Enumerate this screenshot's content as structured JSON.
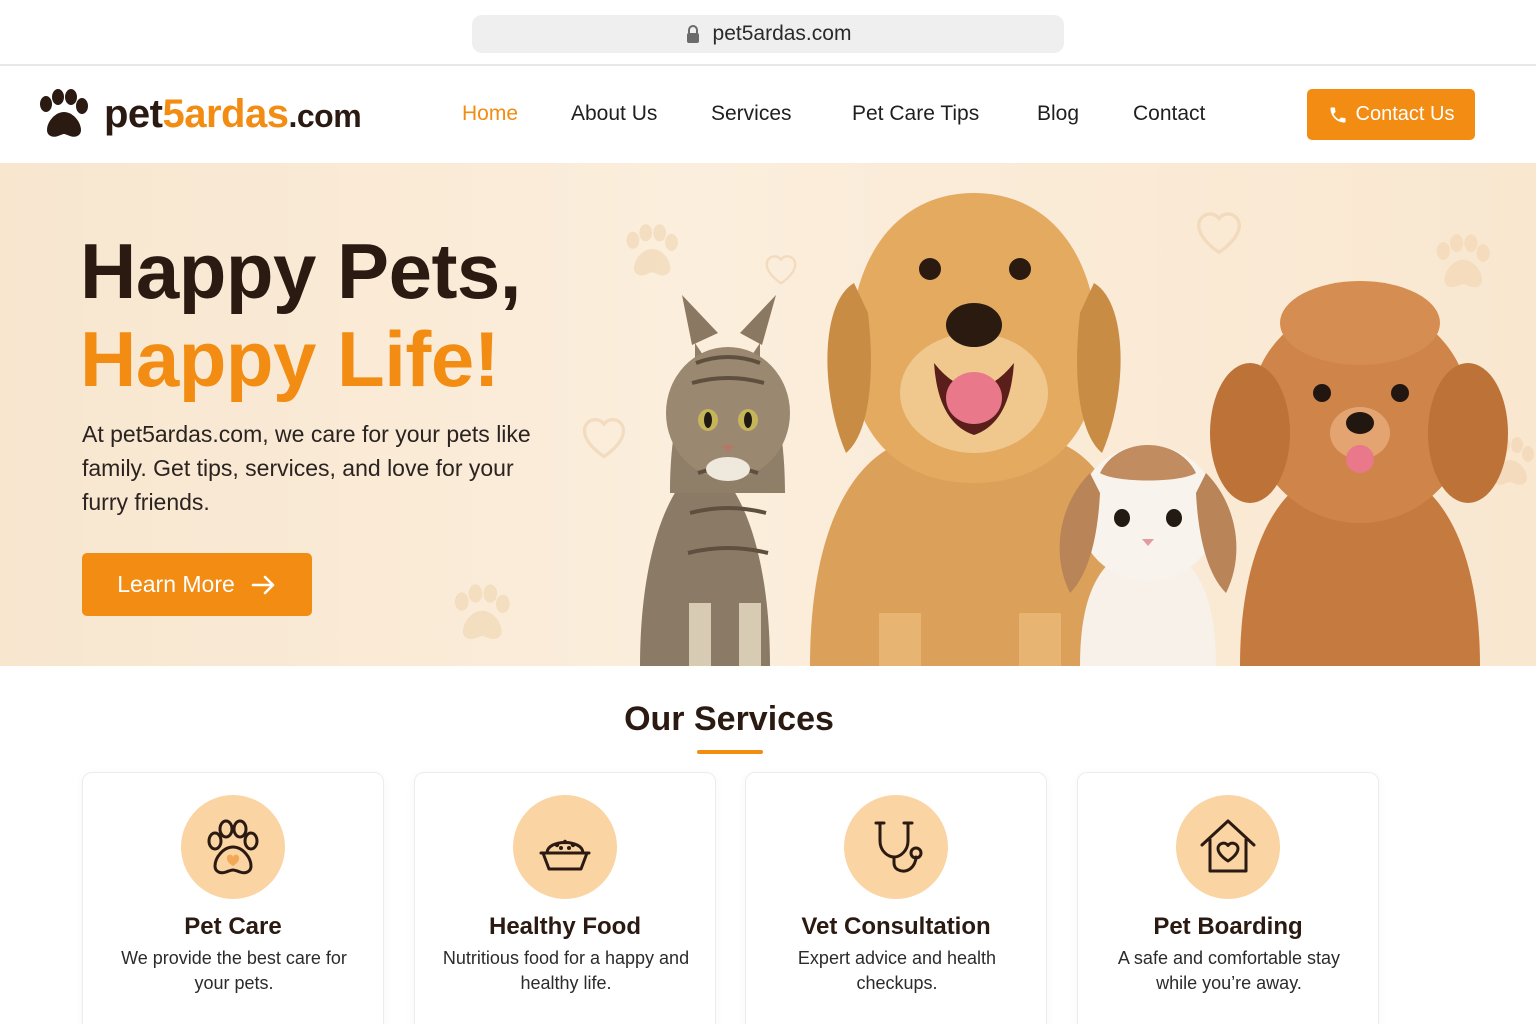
{
  "browser": {
    "url": "pet5ardas.com"
  },
  "brand": {
    "name_part1": "pet",
    "name_accent": "5ardas",
    "name_tld": ".com",
    "accent_color": "#f28c12",
    "dark_color": "#2b1a12"
  },
  "nav": {
    "items": [
      {
        "label": "Home",
        "active": true
      },
      {
        "label": "About Us",
        "active": false
      },
      {
        "label": "Services",
        "active": false
      },
      {
        "label": "Pet Care Tips",
        "active": false
      },
      {
        "label": "Blog",
        "active": false
      },
      {
        "label": "Contact",
        "active": false
      }
    ],
    "cta_label": "Contact Us"
  },
  "hero": {
    "title_line1": "Happy Pets,",
    "title_line2": "Happy Life!",
    "description": "At pet5ardas.com, we care for your pets like family. Get tips, services, and love for your furry friends.",
    "button_label": "Learn More"
  },
  "services": {
    "heading": "Our Services",
    "cards": [
      {
        "icon": "paw-icon",
        "title": "Pet Care",
        "description": "We provide the best care for your pets."
      },
      {
        "icon": "food-bowl-icon",
        "title": "Healthy Food",
        "description": "Nutritious food for a happy and healthy life."
      },
      {
        "icon": "stethoscope-icon",
        "title": "Vet Consultation",
        "description": "Expert advice and health checkups."
      },
      {
        "icon": "house-heart-icon",
        "title": "Pet Boarding",
        "description": "A safe and comfortable stay while you’re away."
      }
    ]
  }
}
